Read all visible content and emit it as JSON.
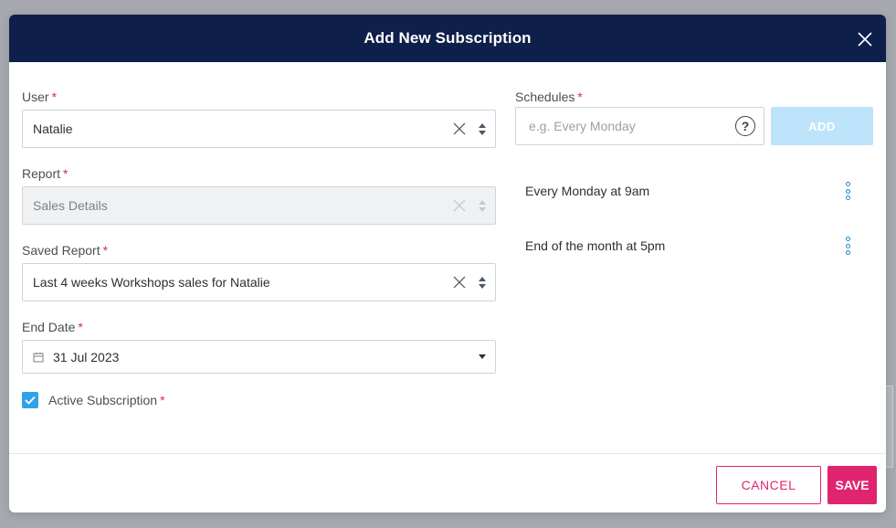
{
  "modal": {
    "title": "Add New Subscription"
  },
  "form": {
    "user": {
      "label": "User",
      "required": "*",
      "value": "Natalie"
    },
    "report": {
      "label": "Report",
      "required": "*",
      "value": "Sales Details"
    },
    "saved_report": {
      "label": "Saved Report",
      "required": "*",
      "value": "Last 4 weeks Workshops sales for Natalie"
    },
    "end_date": {
      "label": "End Date",
      "required": "*",
      "value": "31 Jul 2023"
    },
    "active": {
      "label": "Active Subscription",
      "required": "*",
      "checked": true
    }
  },
  "schedules": {
    "label": "Schedules",
    "required": "*",
    "placeholder": "e.g. Every Monday",
    "help": "?",
    "add_label": "ADD",
    "items": [
      {
        "label": "Every Monday at 9am"
      },
      {
        "label": "End of the month at 5pm"
      }
    ]
  },
  "footer": {
    "cancel_label": "CANCEL",
    "save_label": "SAVE"
  },
  "colors": {
    "header_bg": "#0f1f4b",
    "accent_pink": "#e0246f",
    "checkbox_blue": "#2ea3e8",
    "add_disabled": "#bde4fb"
  }
}
